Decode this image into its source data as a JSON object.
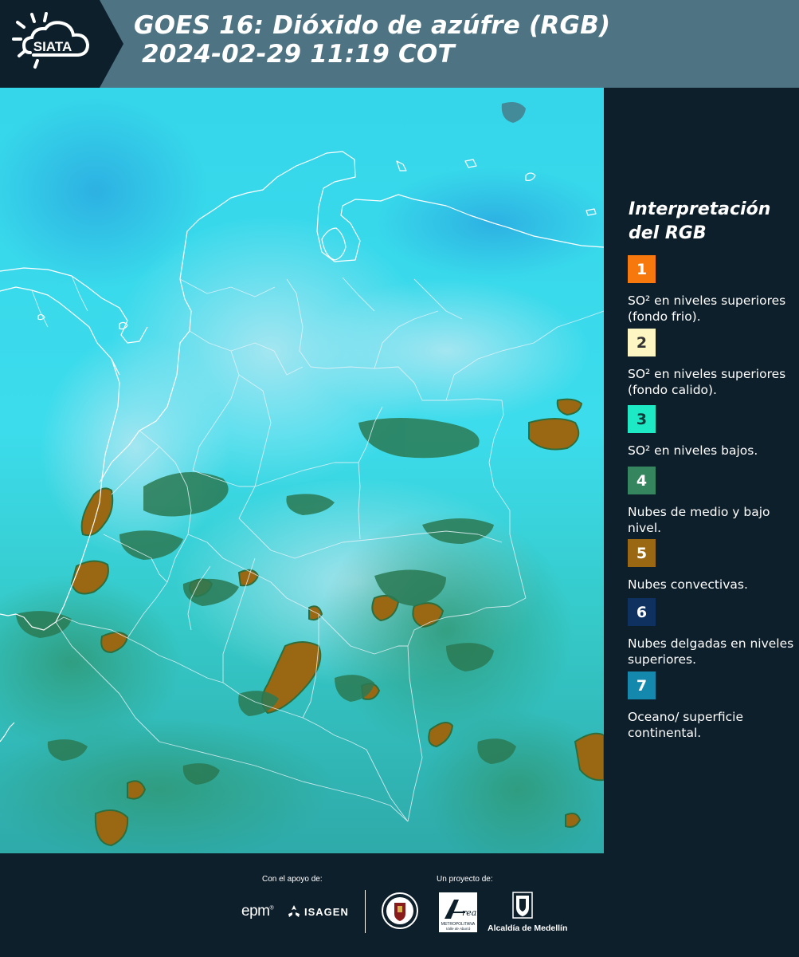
{
  "header": {
    "logo_text": "SIATA",
    "title_line1": "GOES 16: Dióxido de azúfre (RGB)",
    "title_line2": "2024-02-29 11:19 COT"
  },
  "legend": {
    "title": "Interpretación del RGB",
    "items": [
      {
        "number": "1",
        "color": "#f7790e",
        "text_color": "#ffffff",
        "label": "SO² en niveles superiores (fondo frio)."
      },
      {
        "number": "2",
        "color": "#fdf6c2",
        "text_color": "#333333",
        "label": "SO² en niveles superiores (fondo calido)."
      },
      {
        "number": "3",
        "color": "#1ee9c5",
        "text_color": "#0e3b3a",
        "label": "SO² en niveles bajos."
      },
      {
        "number": "4",
        "color": "#35855f",
        "text_color": "#ffffff",
        "label": "Nubes de medio y bajo nivel."
      },
      {
        "number": "5",
        "color": "#9a6813",
        "text_color": "#ffffff",
        "label": "Nubes convectivas."
      },
      {
        "number": "6",
        "color": "#0f3160",
        "text_color": "#ffffff",
        "label": "Nubes delgadas en niveles superiores."
      },
      {
        "number": "7",
        "color": "#1589ad",
        "text_color": "#ffffff",
        "label": "Oceano/ superficie continental."
      }
    ]
  },
  "footer": {
    "support_label": "Con el apoyo de:",
    "project_label": "Un proyecto de:",
    "sponsor1": "epm",
    "sponsor2": "ISAGEN",
    "partner_area_line1": "METROPOLITANA",
    "partner_area_line2": "Valle de Aburrá",
    "partner_alcaldia": "Alcaldía de Medellín"
  },
  "colors": {
    "header_bg": "#4e7383",
    "logo_bg": "#0e1f2c",
    "panel_bg": "#0e1f2c",
    "map_base": "#2fd8ea"
  }
}
